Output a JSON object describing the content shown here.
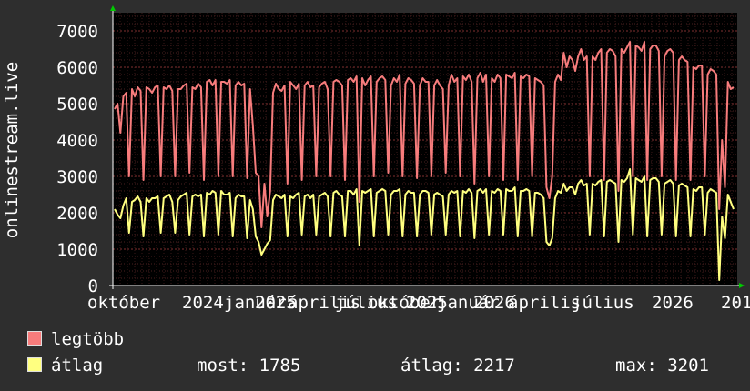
{
  "chart_data": {
    "type": "line",
    "title": "",
    "ylabel": "onlinestream.live",
    "xlabel": "",
    "ylim": [
      0,
      7500
    ],
    "yticks": [
      0,
      1000,
      2000,
      3000,
      4000,
      5000,
      6000,
      7000
    ],
    "grid": true,
    "xtick_labels": [
      "október",
      "2024",
      "január",
      "2025",
      "április",
      "július",
      "október",
      "2025",
      "január",
      "2026",
      "április",
      "július",
      "2026",
      "201"
    ],
    "series": [
      {
        "name": "legtöbb",
        "color": "#f77c7c",
        "values": [
          4850,
          5000,
          4200,
          5200,
          5300,
          3000,
          5400,
          5200,
          5450,
          5350,
          2900,
          5450,
          5400,
          5300,
          5450,
          5500,
          3000,
          5450,
          5400,
          5500,
          5350,
          3000,
          5400,
          5400,
          5500,
          5550,
          3100,
          5450,
          5400,
          5550,
          5450,
          2900,
          5600,
          5650,
          5500,
          5650,
          3000,
          5600,
          5600,
          5550,
          5650,
          3000,
          5500,
          5600,
          5500,
          5550,
          2950,
          5400,
          4400,
          3100,
          3000,
          1600,
          2800,
          1900,
          2600,
          5300,
          5550,
          5400,
          5350,
          5500,
          2800,
          5600,
          5500,
          5400,
          5550,
          2900,
          5500,
          5600,
          5450,
          5500,
          3000,
          5450,
          5550,
          5600,
          5400,
          3000,
          5600,
          5650,
          5600,
          5500,
          2900,
          5650,
          5700,
          5600,
          5750,
          2300,
          5700,
          5500,
          5650,
          5750,
          3000,
          5600,
          5700,
          5750,
          5650,
          3100,
          5500,
          5700,
          5600,
          5800,
          3000,
          5550,
          5700,
          5650,
          5550,
          2950,
          5500,
          5700,
          5600,
          5600,
          3000,
          5500,
          5650,
          5500,
          5400,
          3100,
          5500,
          5800,
          5600,
          5700,
          3000,
          5750,
          5650,
          5800,
          5600,
          2800,
          5700,
          5850,
          5600,
          5800,
          3000,
          5700,
          5600,
          5800,
          5700,
          2900,
          5800,
          5750,
          5700,
          5850,
          2900,
          5750,
          5700,
          5800,
          5750,
          3000,
          5700,
          5650,
          5600,
          5500,
          2700,
          2400,
          3000,
          5600,
          5800,
          5650,
          6400,
          6000,
          6300,
          6200,
          5900,
          6300,
          6500,
          6200,
          6300,
          3000,
          6300,
          6200,
          6400,
          6500,
          2900,
          6400,
          6500,
          6450,
          6300,
          2600,
          6500,
          6400,
          6550,
          6700,
          3000,
          6600,
          6550,
          6450,
          6700,
          2900,
          6500,
          6600,
          6600,
          6450,
          3000,
          6300,
          6450,
          6500,
          6400,
          2900,
          6200,
          6300,
          6200,
          6150,
          2900,
          6000,
          5950,
          6050,
          6050,
          3000,
          5800,
          5950,
          5900,
          5800,
          2100,
          4000,
          2700,
          5600,
          5400,
          5450
        ]
      },
      {
        "name": "átlag",
        "color": "#ffff80",
        "values": [
          2100,
          1950,
          1850,
          2200,
          2400,
          1450,
          2300,
          2350,
          2450,
          2300,
          1350,
          2400,
          2300,
          2400,
          2400,
          2450,
          1450,
          2400,
          2450,
          2500,
          2300,
          1450,
          2350,
          2450,
          2500,
          2550,
          1400,
          2450,
          2500,
          2450,
          2500,
          1350,
          2550,
          2500,
          2600,
          2550,
          1400,
          2600,
          2500,
          2500,
          2550,
          1350,
          2400,
          2500,
          2450,
          2450,
          1300,
          2350,
          2100,
          1350,
          1200,
          850,
          1000,
          1150,
          1250,
          2350,
          2500,
          2450,
          2400,
          2500,
          1350,
          2450,
          2400,
          2500,
          2550,
          1400,
          2450,
          2500,
          2400,
          2500,
          1400,
          2450,
          2500,
          2550,
          2450,
          1350,
          2550,
          2600,
          2500,
          2450,
          1350,
          2600,
          2600,
          2500,
          2650,
          1100,
          2600,
          2550,
          2600,
          2650,
          1350,
          2550,
          2600,
          2650,
          2600,
          1400,
          2500,
          2600,
          2600,
          2650,
          1350,
          2500,
          2600,
          2550,
          2550,
          1350,
          2500,
          2600,
          2600,
          2550,
          1400,
          2500,
          2550,
          2500,
          2450,
          1400,
          2500,
          2600,
          2550,
          2600,
          1350,
          2600,
          2550,
          2650,
          2550,
          1300,
          2600,
          2650,
          2550,
          2650,
          1400,
          2600,
          2550,
          2650,
          2600,
          1400,
          2650,
          2600,
          2600,
          2700,
          1350,
          2600,
          2600,
          2650,
          2600,
          1350,
          2550,
          2550,
          2500,
          2400,
          1200,
          1100,
          1300,
          2400,
          2600,
          2550,
          2800,
          2600,
          2700,
          2700,
          2500,
          2800,
          2900,
          2750,
          2800,
          1400,
          2800,
          2750,
          2850,
          2900,
          1350,
          2850,
          2900,
          2850,
          2800,
          1200,
          2900,
          2850,
          2950,
          3201,
          1400,
          2950,
          2900,
          2850,
          3000,
          1350,
          2900,
          2950,
          2950,
          2850,
          1400,
          2800,
          2850,
          2900,
          2800,
          1350,
          2750,
          2800,
          2750,
          2700,
          1350,
          2650,
          2600,
          2700,
          2700,
          1400,
          2550,
          2650,
          2600,
          2550,
          150,
          1900,
          1300,
          2500,
          2300,
          2100
        ]
      }
    ]
  },
  "legend": [
    {
      "label": "legtöbb",
      "color": "#f77c7c"
    },
    {
      "label": "átlag",
      "color": "#ffff80"
    }
  ],
  "stats": {
    "now": "most: 1785",
    "avg": "átlag: 2217",
    "max": "max: 3201"
  }
}
